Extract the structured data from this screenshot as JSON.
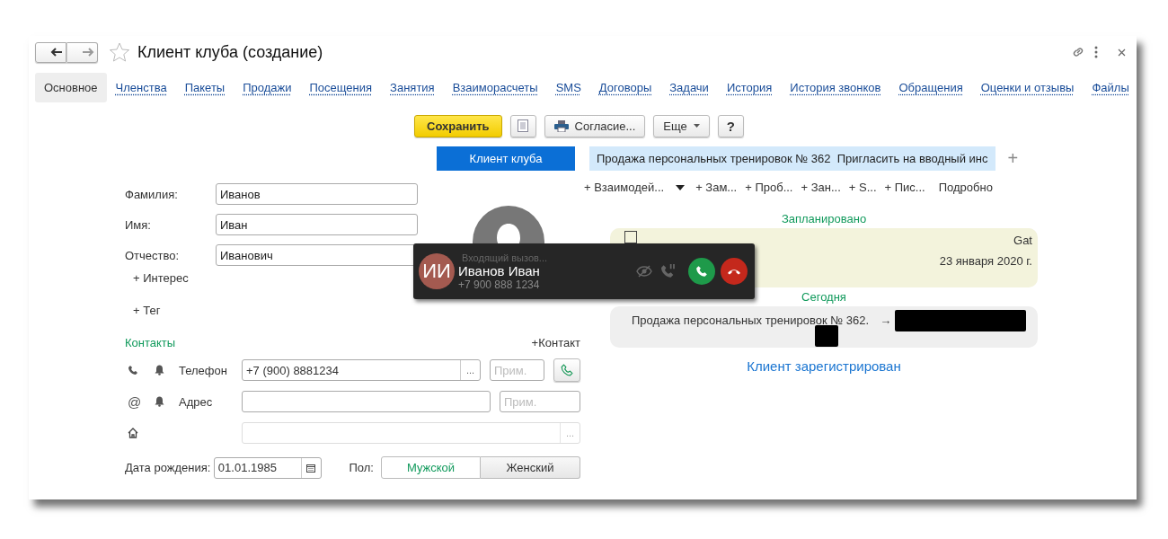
{
  "window": {
    "title": "Клиент клуба (создание)"
  },
  "tabs": [
    {
      "label": "Основное",
      "selected": true
    },
    {
      "label": "Членства",
      "selected": false
    },
    {
      "label": "Пакеты",
      "selected": false
    },
    {
      "label": "Продажи",
      "selected": false
    },
    {
      "label": "Посещения",
      "selected": false
    },
    {
      "label": "Занятия",
      "selected": false
    },
    {
      "label": "Взаиморасчеты",
      "selected": false
    },
    {
      "label": "SMS",
      "selected": false
    },
    {
      "label": "Договоры",
      "selected": false
    },
    {
      "label": "Задачи",
      "selected": false
    },
    {
      "label": "История",
      "selected": false
    },
    {
      "label": "История звонков",
      "selected": false
    },
    {
      "label": "Обращения",
      "selected": false
    },
    {
      "label": "Оценки и отзывы",
      "selected": false
    },
    {
      "label": "Файлы",
      "selected": false
    }
  ],
  "toolbar": {
    "save": "Сохранить",
    "consent": "Согласие...",
    "more": "Еще",
    "help": "?"
  },
  "person_fields": [
    {
      "label": "Фамилия:",
      "value": "Иванов"
    },
    {
      "label": "Имя:",
      "value": "Иван"
    },
    {
      "label": "Отчество:",
      "value": "Иванович"
    }
  ],
  "add_links": [
    "+ Интерес",
    "+ Тег"
  ],
  "contacts": {
    "title": "Контакты",
    "add": "+Контакт",
    "rows": [
      {
        "kind": "phone",
        "label": "Телефон",
        "value": "+7 (900) 8881234",
        "more": "...",
        "note_placeholder": "Прим."
      },
      {
        "kind": "email",
        "icon": "@",
        "label": "Адрес",
        "note_placeholder": "Прим."
      },
      {
        "kind": "address",
        "more": "..."
      }
    ]
  },
  "birth": {
    "label": "Дата рождения:",
    "value": "01.01.1985"
  },
  "gender": {
    "label": "Пол:",
    "options": [
      {
        "label": "Мужской",
        "selected": true
      },
      {
        "label": "Женский",
        "selected": false
      }
    ]
  },
  "panel_tabs": [
    {
      "label": "Клиент клуба",
      "selected": true
    },
    {
      "label": "Продажа персональных тренировок № 362  Пригласить на вводный инс",
      "selected": false
    }
  ],
  "panel_add": "+",
  "actions": [
    "+ Взаимодей...",
    "+ Зам...",
    "+ Проб...",
    "+ Зан...",
    "+ S...",
    "+ Пис..."
  ],
  "details": "Подробно",
  "timeline": [
    {
      "kind": "heading",
      "text": "Запланировано"
    },
    {
      "kind": "task",
      "checked": false,
      "author": "Gat",
      "date": "23 января 2020 г."
    },
    {
      "kind": "heading",
      "text": "Сегодня"
    },
    {
      "kind": "event",
      "text": "Продажа персональных тренировок № 362.",
      "arrow": "→"
    },
    {
      "kind": "status",
      "text": "Клиент зарегистрирован"
    }
  ],
  "call": {
    "status": "Входящий вызов...",
    "initials": "ИИ",
    "name": "Иванов Иван",
    "phone": "+7 900 888 1234"
  }
}
